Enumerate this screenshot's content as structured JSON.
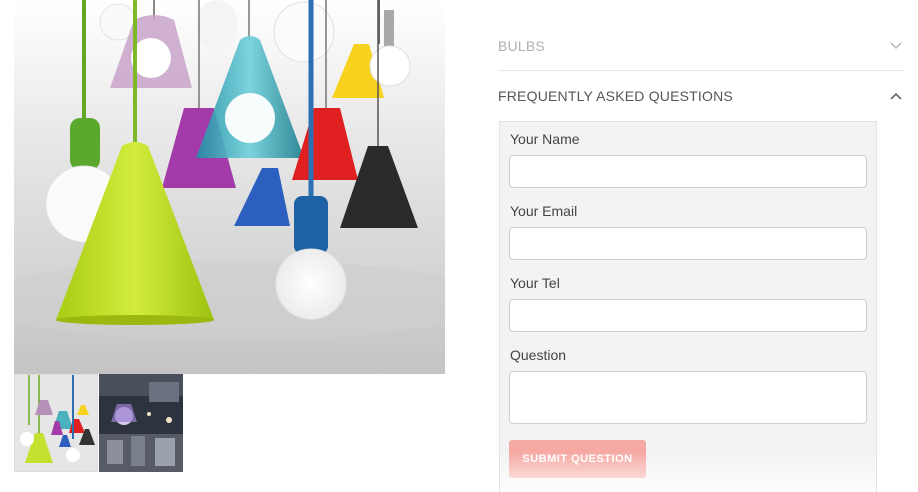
{
  "accordion": {
    "bulbs_label": "BULBS",
    "faq_label": "FREQUENTLY ASKED QUESTIONS"
  },
  "form": {
    "name_label": "Your Name",
    "email_label": "Your Email",
    "tel_label": "Your Tel",
    "question_label": "Question",
    "submit_label": "SUBMIT QUESTION"
  },
  "icons": {
    "bulbs_chevron": "chevron-down-icon",
    "faq_chevron": "chevron-up-icon"
  },
  "colors": {
    "submit_bg": "#f6a9a3",
    "panel_bg": "#f3f3f3",
    "muted_text": "#b0b0b0"
  }
}
